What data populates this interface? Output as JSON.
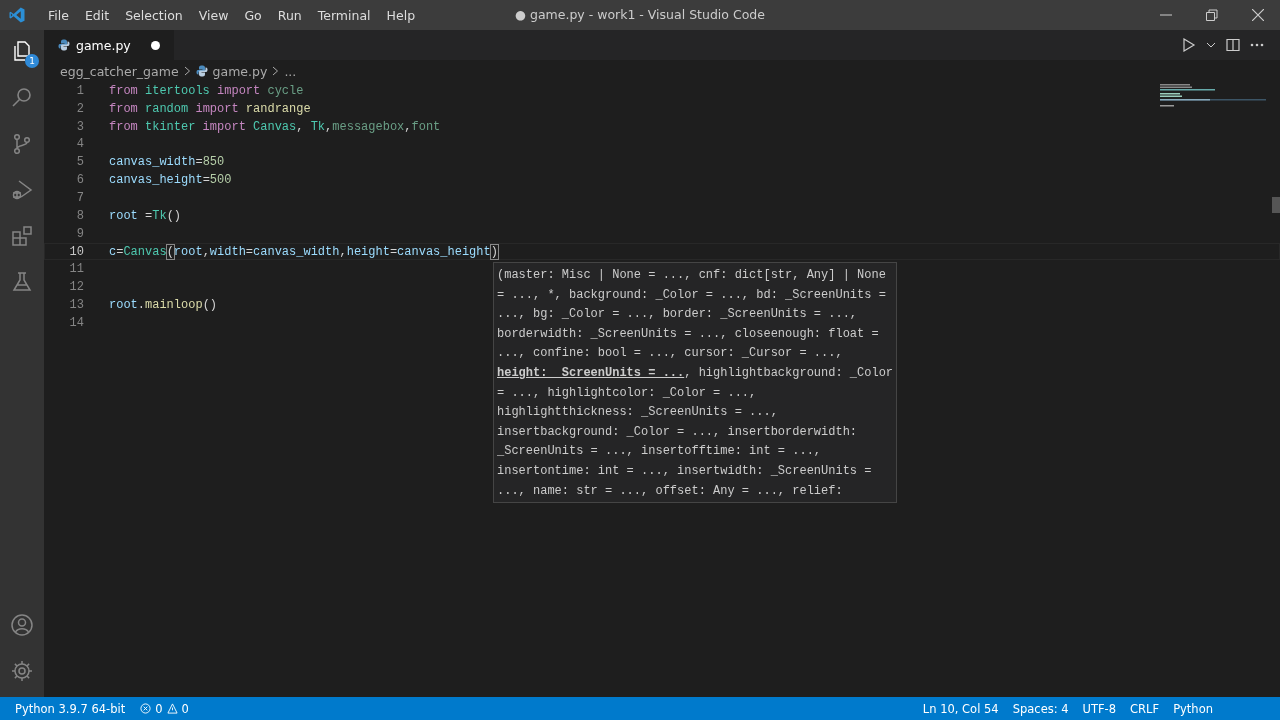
{
  "window": {
    "title": "● game.py - work1 - Visual Studio Code"
  },
  "menu": [
    "File",
    "Edit",
    "Selection",
    "View",
    "Go",
    "Run",
    "Terminal",
    "Help"
  ],
  "activity_bar": {
    "explorer_badge": "1"
  },
  "tabs": [
    {
      "label": "game.py",
      "selected": true,
      "dirty": true
    }
  ],
  "breadcrumb": [
    {
      "text": "egg_catcher_game",
      "kind": "folder"
    },
    {
      "text": "game.py",
      "kind": "file"
    },
    {
      "text": "...",
      "kind": "symbol"
    }
  ],
  "editor": {
    "lines": [
      {
        "number": "1",
        "current": false,
        "tokens": [
          {
            "text": "from",
            "kind": "keyword"
          },
          {
            "text": " itertools",
            "kind": "module"
          },
          {
            "text": " import",
            "kind": "keyword"
          },
          {
            "text": " cycle",
            "kind": "name"
          }
        ]
      },
      {
        "number": "2",
        "current": false,
        "tokens": [
          {
            "text": "from",
            "kind": "keyword"
          },
          {
            "text": " random",
            "kind": "module"
          },
          {
            "text": " import",
            "kind": "keyword"
          },
          {
            "text": " randrange",
            "kind": "function"
          }
        ]
      },
      {
        "number": "3",
        "current": false,
        "tokens": [
          {
            "text": "from",
            "kind": "keyword"
          },
          {
            "text": " tkinter",
            "kind": "module"
          },
          {
            "text": " import",
            "kind": "keyword"
          },
          {
            "text": " Canvas",
            "kind": "class"
          },
          {
            "text": ", ",
            "kind": "plain"
          },
          {
            "text": "Tk",
            "kind": "class"
          },
          {
            "text": ",",
            "kind": "plain"
          },
          {
            "text": "messagebox",
            "kind": "name"
          },
          {
            "text": ",",
            "kind": "plain"
          },
          {
            "text": "font",
            "kind": "name"
          }
        ]
      },
      {
        "number": "4",
        "current": false
      },
      {
        "number": "5",
        "current": false,
        "tokens": [
          {
            "text": "canvas_width",
            "kind": "variable"
          },
          {
            "text": "=",
            "kind": "plain"
          },
          {
            "text": "850",
            "kind": "number"
          }
        ]
      },
      {
        "number": "6",
        "current": false,
        "tokens": [
          {
            "text": "canvas_height",
            "kind": "variable"
          },
          {
            "text": "=",
            "kind": "plain"
          },
          {
            "text": "500",
            "kind": "number"
          }
        ]
      },
      {
        "number": "7",
        "current": false
      },
      {
        "number": "8",
        "current": false,
        "tokens": [
          {
            "text": "root",
            "kind": "variable"
          },
          {
            "text": " =",
            "kind": "plain"
          },
          {
            "text": "Tk",
            "kind": "class"
          },
          {
            "text": "()",
            "kind": "plain"
          }
        ]
      },
      {
        "number": "9",
        "current": false
      },
      {
        "number": "10",
        "current": true,
        "tokens": [
          {
            "text": "c",
            "kind": "variable"
          },
          {
            "text": "=",
            "kind": "plain"
          },
          {
            "text": "Canvas",
            "kind": "class"
          },
          {
            "text": "(",
            "kind": "bracket-match"
          },
          {
            "text": "root",
            "kind": "variable"
          },
          {
            "text": ",",
            "kind": "plain"
          },
          {
            "text": "width",
            "kind": "variable"
          },
          {
            "text": "=",
            "kind": "plain"
          },
          {
            "text": "canvas_width",
            "kind": "variable"
          },
          {
            "text": ",",
            "kind": "plain"
          },
          {
            "text": "height",
            "kind": "variable"
          },
          {
            "text": "=",
            "kind": "plain"
          },
          {
            "text": "canvas_height",
            "kind": "variable"
          },
          {
            "text": ")",
            "kind": "bracket-match"
          }
        ]
      },
      {
        "number": "11",
        "current": false
      },
      {
        "number": "12",
        "current": false
      },
      {
        "number": "13",
        "current": false,
        "tokens": [
          {
            "text": "root",
            "kind": "variable"
          },
          {
            "text": ".",
            "kind": "plain"
          },
          {
            "text": "mainloop",
            "kind": "function"
          },
          {
            "text": "()",
            "kind": "plain"
          }
        ]
      },
      {
        "number": "14",
        "current": false
      }
    ]
  },
  "signature_help": {
    "lines": [
      [
        {
          "text": "(master: Misc | None = ..., cnf: dict[str, Any] | None",
          "active": false
        }
      ],
      [
        {
          "text": "= ..., *, background: _Color = ..., bd: _ScreenUnits =",
          "active": false
        }
      ],
      [
        {
          "text": "..., bg: _Color = ..., border: _ScreenUnits = ...,",
          "active": false
        }
      ],
      [
        {
          "text": "borderwidth: _ScreenUnits = ..., closeenough: float =",
          "active": false
        }
      ],
      [
        {
          "text": "..., confine: bool = ..., cursor: _Cursor = ...,",
          "active": false
        }
      ],
      [
        {
          "text": "height: _ScreenUnits = ...",
          "active": true
        },
        {
          "text": ", highlightbackground: _Color",
          "active": false
        }
      ],
      [
        {
          "text": "= ..., highlightcolor: _Color = ...,",
          "active": false
        }
      ],
      [
        {
          "text": "highlightthickness: _ScreenUnits = ...,",
          "active": false
        }
      ],
      [
        {
          "text": "insertbackground: _Color = ..., insertborderwidth:",
          "active": false
        }
      ],
      [
        {
          "text": "_ScreenUnits = ..., insertofftime: int = ...,",
          "active": false
        }
      ],
      [
        {
          "text": "insertontime: int = ..., insertwidth: _ScreenUnits =",
          "active": false
        }
      ],
      [
        {
          "text": "..., name: str = ..., offset: Any = ..., relief:",
          "active": false
        }
      ]
    ]
  },
  "status_bar": {
    "interpreter": "Python 3.9.7 64-bit",
    "errors": "0",
    "warnings": "0",
    "right": [
      "Ln 10, Col 54",
      "Spaces: 4",
      "UTF-8",
      "CRLF",
      "Python"
    ]
  }
}
